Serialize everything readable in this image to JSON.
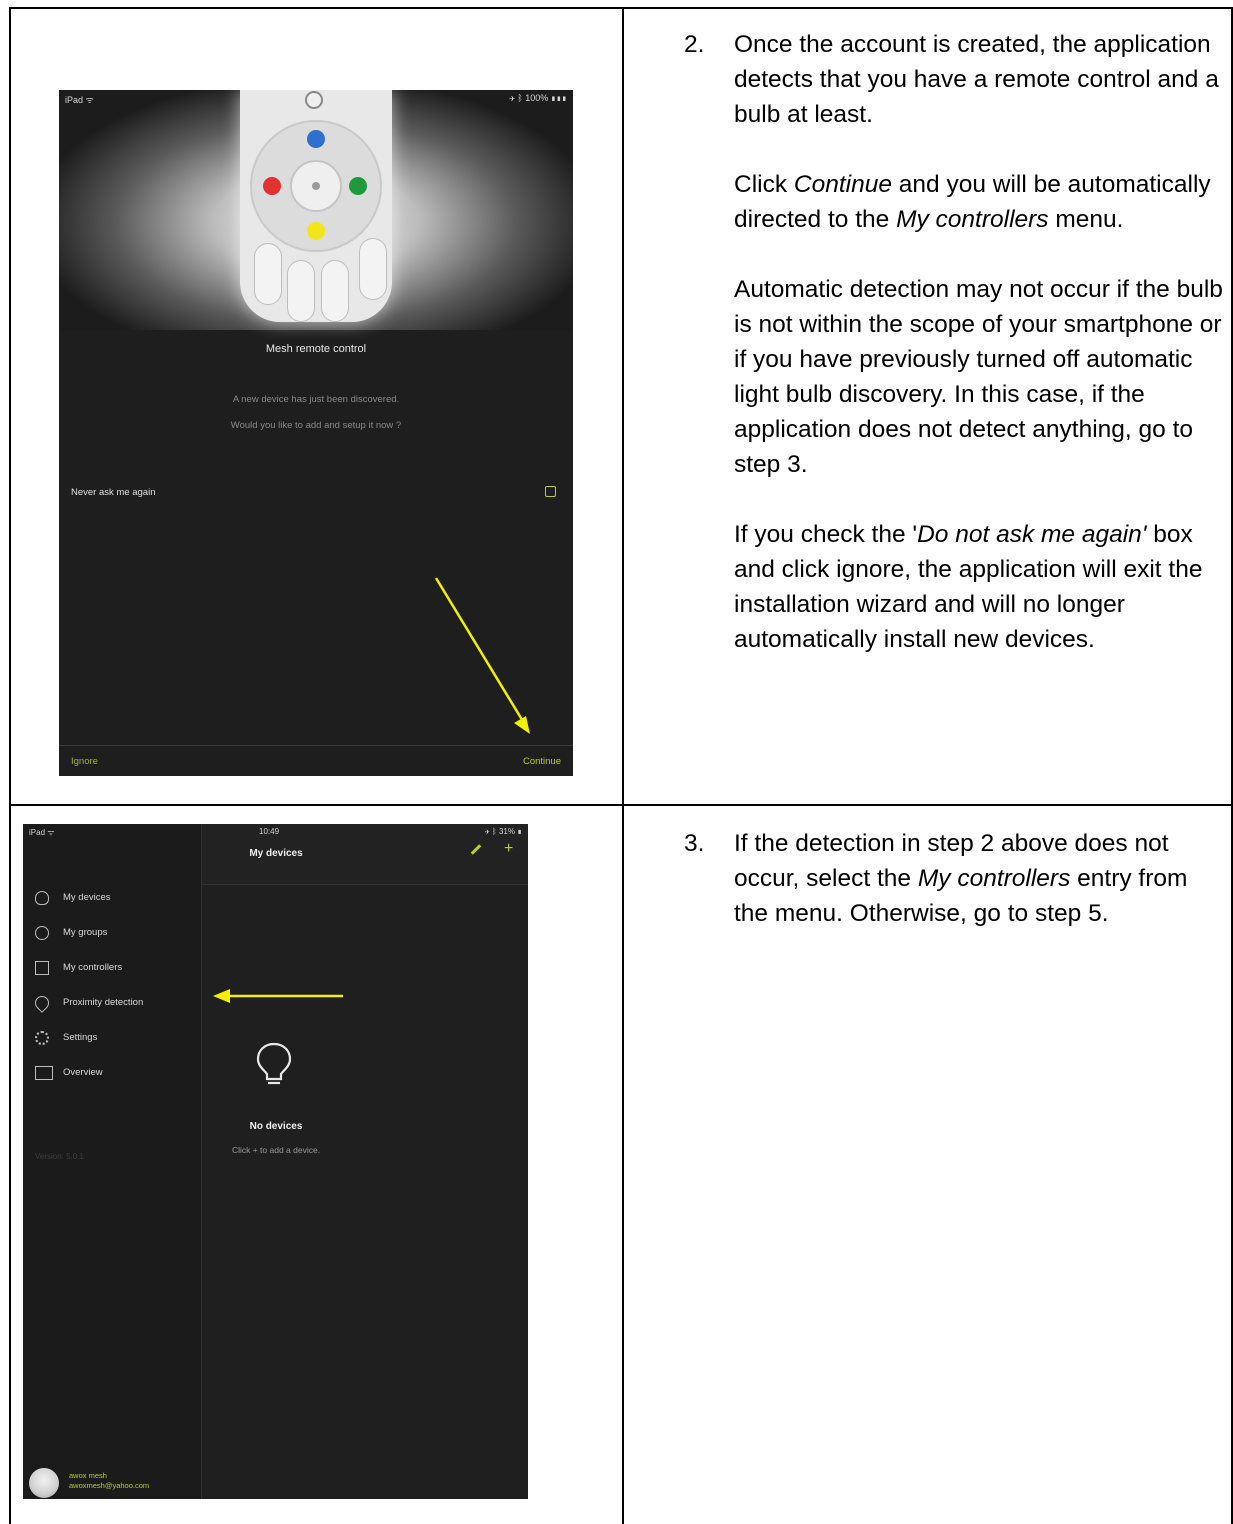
{
  "step2": {
    "number": "2.",
    "p1": "Once the account is created, the application detects that you have a remote control and a bulb at least.",
    "p2_pre": "Click ",
    "p2_em1": "Continue",
    "p2_mid": " and you will be automatically directed to the ",
    "p2_em2": "My controllers",
    "p2_post": " menu.",
    "p3": "Automatic detection may not occur if the bulb is not within the scope of your smartphone or if you have previously turned off automatic light bulb discovery. In this case, if the application does not detect anything, go to step 3.",
    "p4_pre": "If you check the '",
    "p4_em": "Do not ask me again'",
    "p4_post": " box and click ignore, the application will exit the installation wizard and will no longer automatically install new devices."
  },
  "step3": {
    "number": "3.",
    "p1_pre": "If the detection in step 2 above does not occur, select the ",
    "p1_em": "My controllers",
    "p1_post": " entry from the menu. Otherwise, go to step 5."
  },
  "screen1": {
    "status_left": "iPad ᯤ",
    "status_right": "✈ ᛒ 100% ▮▮▮",
    "title": "Mesh remote control",
    "message_line1": "A new device has just been discovered.",
    "message_line2": "Would you like to add and setup it now ?",
    "never_ask": "Never ask me again",
    "ignore": "Ignore",
    "continue": "Continue",
    "colors": {
      "blue": "#2f6fd0",
      "red": "#e33030",
      "green": "#1f9a3a",
      "yellow": "#f2e51a",
      "accent": "#b6d12a"
    }
  },
  "screen2": {
    "status_left": "iPad ᯤ",
    "status_center": "10:49",
    "status_right": "✈ ᛒ 31% ▮",
    "header_title": "My devices",
    "menu": [
      {
        "label": "My devices",
        "icon": "bulb-icon"
      },
      {
        "label": "My groups",
        "icon": "groups-icon"
      },
      {
        "label": "My controllers",
        "icon": "controller-icon"
      },
      {
        "label": "Proximity detection",
        "icon": "location-pin-icon"
      },
      {
        "label": "Settings",
        "icon": "gear-icon"
      },
      {
        "label": "Overview",
        "icon": "overview-icon"
      }
    ],
    "version": "Version: 5.0.1",
    "no_devices": "No devices",
    "click_add": "Click + to add a device.",
    "user_name": "awox mesh",
    "user_email": "awoxmesh@yahoo.com"
  }
}
